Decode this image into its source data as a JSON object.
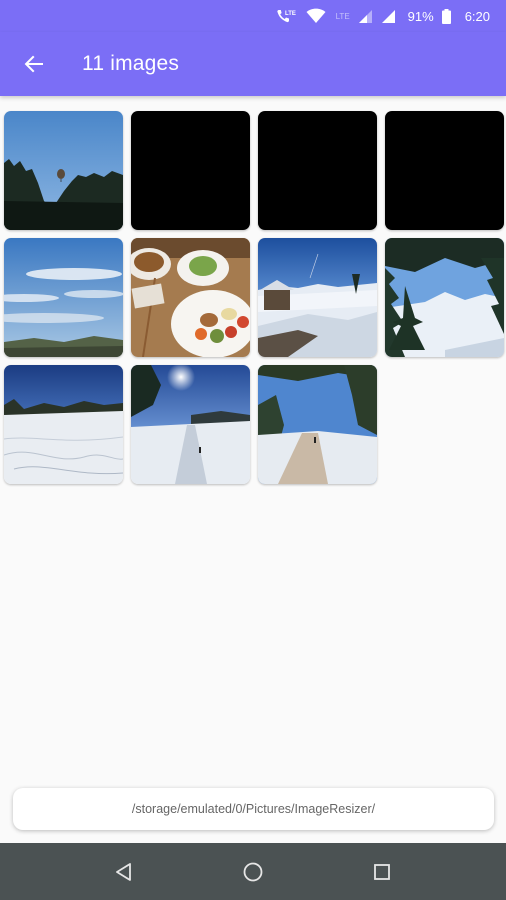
{
  "status_bar": {
    "lte_call_label": "LTE",
    "lte_small_label": "LTE",
    "battery": "91%",
    "time": "6:20",
    "icons": [
      "lte-call-icon",
      "wifi-icon",
      "signal-icon",
      "signal-icon",
      "battery-icon"
    ]
  },
  "app_bar": {
    "title": "11 images",
    "back_icon": "arrow-back-icon",
    "color": "#7b6ef6"
  },
  "images": [
    {
      "id": "balloon-sky",
      "name": "image-1"
    },
    {
      "id": "black",
      "name": "image-2"
    },
    {
      "id": "black",
      "name": "image-3"
    },
    {
      "id": "black",
      "name": "image-4"
    },
    {
      "id": "sky-clouds",
      "name": "image-5"
    },
    {
      "id": "food-plates",
      "name": "image-6"
    },
    {
      "id": "snow-hut",
      "name": "image-7"
    },
    {
      "id": "snow-trees",
      "name": "image-8"
    },
    {
      "id": "snow-slope",
      "name": "image-9"
    },
    {
      "id": "snow-sun-path",
      "name": "image-10"
    },
    {
      "id": "snow-trail",
      "name": "image-11"
    }
  ],
  "path": "/storage/emulated/0/Pictures/ImageResizer/",
  "nav_bar": {
    "icons": [
      "back-triangle-icon",
      "home-circle-icon",
      "recents-square-icon"
    ],
    "color": "#4b5253"
  }
}
